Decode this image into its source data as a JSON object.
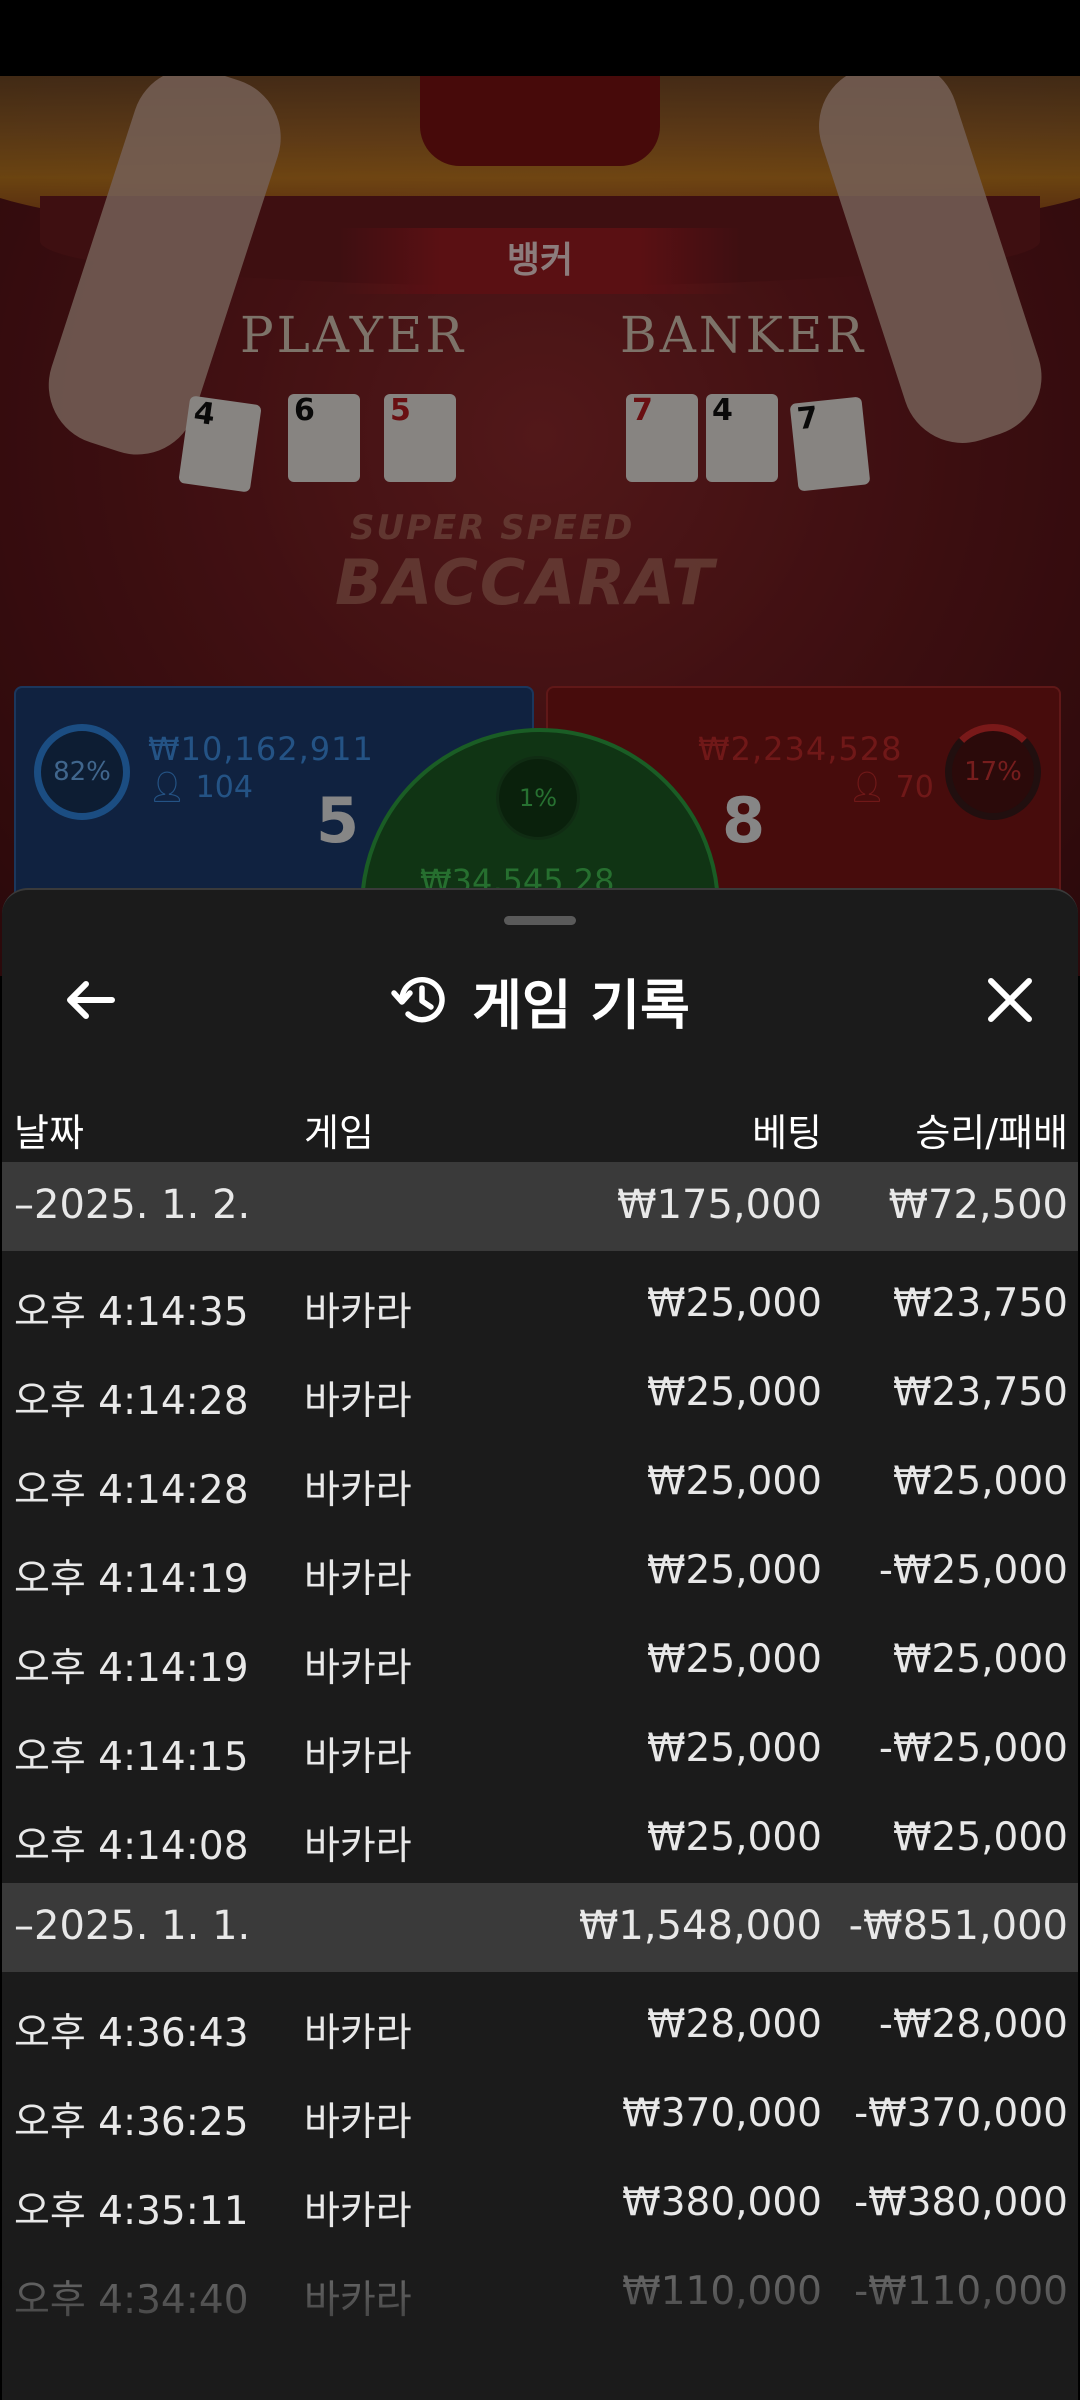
{
  "game_view": {
    "banner": "뱅커",
    "player_label": "PLAYER",
    "banker_label": "BANKER",
    "logo_line1": "SUPER SPEED",
    "logo_line2": "BACCARAT",
    "player_cards": [
      "4",
      "6",
      "5"
    ],
    "banker_cards": [
      "7",
      "4",
      "7"
    ],
    "player_panel": {
      "percent": "82%",
      "amount": "₩10,162,911",
      "bettors": "104",
      "score": "5"
    },
    "banker_panel": {
      "percent": "17%",
      "amount": "₩2,234,528",
      "bettors": "70",
      "score": "8"
    },
    "tie_panel": {
      "percent": "1%",
      "amount": "₩34,545.28"
    }
  },
  "sheet": {
    "title": "게임 기록",
    "icons": {
      "back": "arrow-left-icon",
      "history": "history-icon",
      "close": "close-icon"
    },
    "columns": {
      "date": "날짜",
      "game": "게임",
      "bet": "베팅",
      "win_loss": "승리/패배"
    },
    "groups": [
      {
        "date": "–2025. 1. 2.",
        "bet_total": "₩175,000",
        "win_total": "₩72,500",
        "rows": [
          {
            "time": "오후 4:14:35",
            "game": "바카라",
            "bet": "₩25,000",
            "result": "₩23,750"
          },
          {
            "time": "오후 4:14:28",
            "game": "바카라",
            "bet": "₩25,000",
            "result": "₩23,750"
          },
          {
            "time": "오후 4:14:28",
            "game": "바카라",
            "bet": "₩25,000",
            "result": "₩25,000"
          },
          {
            "time": "오후 4:14:19",
            "game": "바카라",
            "bet": "₩25,000",
            "result": "-₩25,000"
          },
          {
            "time": "오후 4:14:19",
            "game": "바카라",
            "bet": "₩25,000",
            "result": "₩25,000"
          },
          {
            "time": "오후 4:14:15",
            "game": "바카라",
            "bet": "₩25,000",
            "result": "-₩25,000"
          },
          {
            "time": "오후 4:14:08",
            "game": "바카라",
            "bet": "₩25,000",
            "result": "₩25,000"
          }
        ]
      },
      {
        "date": "–2025. 1. 1.",
        "bet_total": "₩1,548,000",
        "win_total": "-₩851,000",
        "rows": [
          {
            "time": "오후 4:36:43",
            "game": "바카라",
            "bet": "₩28,000",
            "result": "-₩28,000"
          },
          {
            "time": "오후 4:36:25",
            "game": "바카라",
            "bet": "₩370,000",
            "result": "-₩370,000"
          },
          {
            "time": "오후 4:35:11",
            "game": "바카라",
            "bet": "₩380,000",
            "result": "-₩380,000"
          },
          {
            "time": "오후 4:34:40",
            "game": "바카라",
            "bet": "₩110,000",
            "result": "-₩110,000"
          }
        ]
      }
    ]
  }
}
